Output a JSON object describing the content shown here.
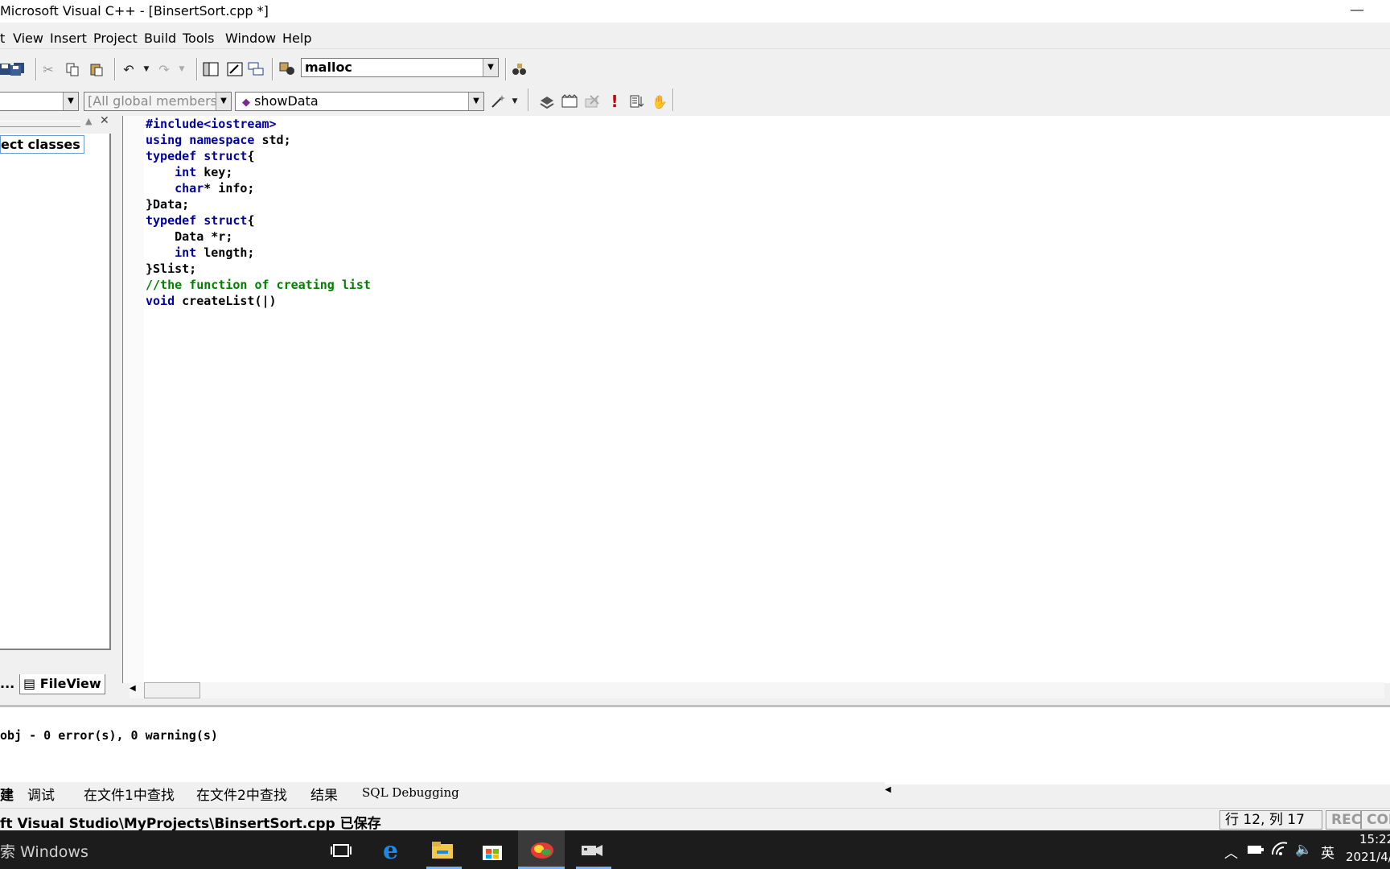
{
  "window": {
    "title": "Microsoft Visual C++ - [BinsertSort.cpp *]",
    "minimize_glyph": "—"
  },
  "menu": {
    "items": [
      "t",
      "View",
      "Insert",
      "Project",
      "Build",
      "Tools",
      "Window",
      "Help"
    ]
  },
  "toolbar": {
    "find_combo_value": "malloc",
    "class_combo_value": "",
    "members_combo_value": "[All global members",
    "function_combo_value": "showData"
  },
  "workspace": {
    "tree_label": "ect classes",
    "tabs": [
      {
        "label": "..."
      },
      {
        "label": "FileView"
      }
    ]
  },
  "editor": {
    "lines": [
      [
        {
          "t": "#include<iostream>",
          "c": "kw2"
        }
      ],
      [
        {
          "t": "using",
          "c": "kw"
        },
        {
          "t": " ",
          "c": ""
        },
        {
          "t": "namespace",
          "c": "kw"
        },
        {
          "t": " std;",
          "c": ""
        }
      ],
      [
        {
          "t": "typedef",
          "c": "kw"
        },
        {
          "t": " ",
          "c": ""
        },
        {
          "t": "struct",
          "c": "kw"
        },
        {
          "t": "{",
          "c": ""
        }
      ],
      [
        {
          "t": "    ",
          "c": ""
        },
        {
          "t": "int",
          "c": "kw"
        },
        {
          "t": " key;",
          "c": ""
        }
      ],
      [
        {
          "t": "    ",
          "c": ""
        },
        {
          "t": "char",
          "c": "kw"
        },
        {
          "t": "* info;",
          "c": ""
        }
      ],
      [
        {
          "t": "}Data;",
          "c": ""
        }
      ],
      [
        {
          "t": "typedef",
          "c": "kw"
        },
        {
          "t": " ",
          "c": ""
        },
        {
          "t": "struct",
          "c": "kw"
        },
        {
          "t": "{",
          "c": ""
        }
      ],
      [
        {
          "t": "    Data *r;",
          "c": ""
        }
      ],
      [
        {
          "t": "    ",
          "c": ""
        },
        {
          "t": "int",
          "c": "kw"
        },
        {
          "t": " length;",
          "c": ""
        }
      ],
      [
        {
          "t": "}Slist;",
          "c": ""
        }
      ],
      [
        {
          "t": "//the function of creating list",
          "c": "cm"
        }
      ],
      [
        {
          "t": "void",
          "c": "kw"
        },
        {
          "t": " createList(|)",
          "c": ""
        }
      ]
    ]
  },
  "output": {
    "text": "obj - 0 error(s), 0 warning(s)",
    "tabs": [
      "建",
      "调试",
      "在文件1中查找",
      "在文件2中查找",
      "结果",
      "SQL Debugging"
    ]
  },
  "status": {
    "path": "ft Visual Studio\\MyProjects\\BinsertSort.cpp 已保存",
    "position": "行 12, 列 17",
    "rec": "REC",
    "col": "COL"
  },
  "taskbar": {
    "search_text": "索 Windows",
    "ime": "英",
    "time": "15:22",
    "date": "2021/4/"
  }
}
